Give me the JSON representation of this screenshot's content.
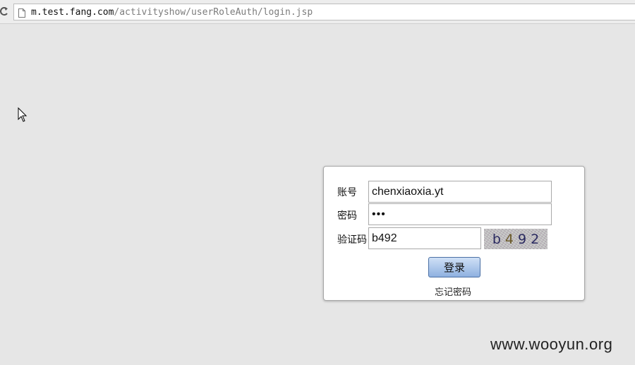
{
  "browser": {
    "url_host": "m.test.fang.com",
    "url_path": "/activityshow/userRoleAuth/login.jsp"
  },
  "login": {
    "account_label": "账号",
    "account_value": "chenxiaoxia.yt",
    "password_label": "密码",
    "password_masked": "•••",
    "captcha_label": "验证码",
    "captcha_value": "b492",
    "captcha_chars": [
      "b",
      "4",
      "9",
      "2"
    ],
    "login_button": "登录",
    "forgot_link": "忘记密码"
  },
  "watermark": "www.wooyun.org"
}
